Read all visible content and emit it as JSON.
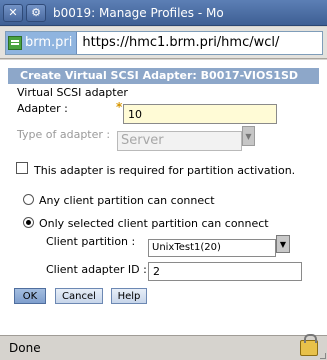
{
  "window": {
    "title": "b0019: Manage Profiles - Mo",
    "close_glyph": "✕",
    "menu_glyph": "⚙"
  },
  "urlbar": {
    "site_label": "brm.pri",
    "url": "https://hmc1.brm.pri/hmc/wcl/"
  },
  "dialog": {
    "title": "Create Virtual SCSI Adapter: B0017-VIOS1SD",
    "section": "Virtual SCSI adapter",
    "adapter_label": "Adapter :",
    "adapter_value": "10",
    "type_label": "Type of adapter :",
    "type_value": "Server",
    "required_checkbox_label": "This adapter is required for partition activation.",
    "radio_any": "Any client partition can connect",
    "radio_selected": "Only selected client partition can connect",
    "client_partition_label": "Client partition :",
    "client_partition_value": "UnixTest1(20)",
    "client_adapter_id_label": "Client adapter ID :",
    "client_adapter_id_value": "2",
    "buttons": {
      "ok": "OK",
      "cancel": "Cancel",
      "help": "Help"
    }
  },
  "status": {
    "text": "Done"
  }
}
